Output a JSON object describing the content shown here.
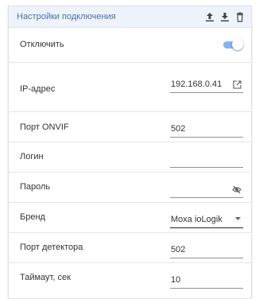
{
  "header": {
    "title": "Настройки подключения",
    "icons": [
      "upload-icon",
      "download-icon",
      "trash-icon"
    ]
  },
  "rows": {
    "disable": {
      "label": "Отключить",
      "toggle_on": true
    },
    "ip": {
      "label": "IP-адрес",
      "value": "192.168.0.41"
    },
    "onvif_port": {
      "label": "Порт ONVIF",
      "value": "502"
    },
    "login": {
      "label": "Логин",
      "value": ""
    },
    "password": {
      "label": "Пароль",
      "value": ""
    },
    "brand": {
      "label": "Бренд",
      "value": "Moxa ioLogik"
    },
    "detector_port": {
      "label": "Порт детектора",
      "value": "502"
    },
    "timeout": {
      "label": "Таймаут, сек",
      "value": "10"
    }
  },
  "colors": {
    "accent": "#4c6ea8",
    "toggle": "#86b4f6"
  }
}
